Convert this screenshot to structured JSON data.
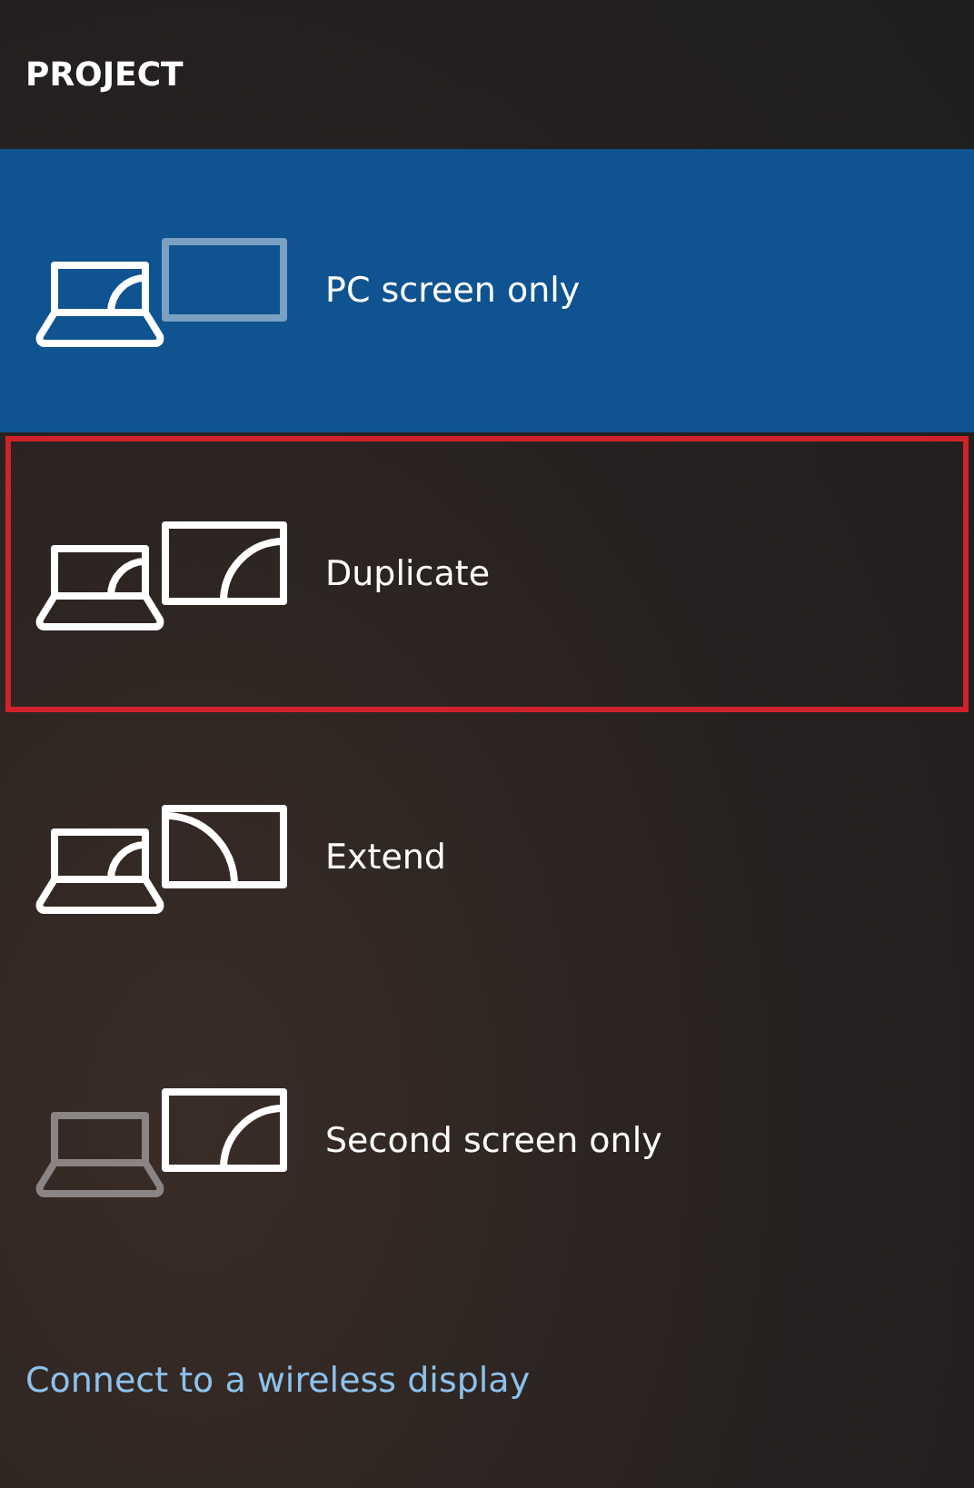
{
  "title": "PROJECT",
  "options": [
    {
      "kind": "pc_only",
      "label": "PC screen only",
      "selected": true,
      "focused": false
    },
    {
      "kind": "duplicate",
      "label": "Duplicate",
      "selected": false,
      "focused": true
    },
    {
      "kind": "extend",
      "label": "Extend",
      "selected": false,
      "focused": false
    },
    {
      "kind": "second_only",
      "label": "Second screen only",
      "selected": false,
      "focused": false
    }
  ],
  "link": "Connect to a wireless display"
}
